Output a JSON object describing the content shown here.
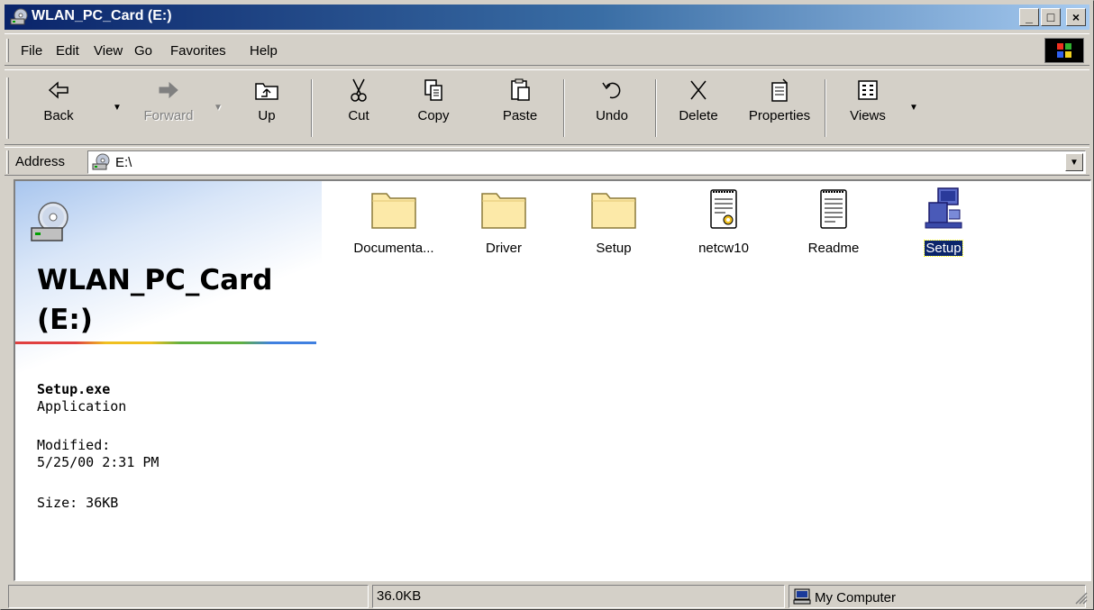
{
  "window": {
    "title": "WLAN_PC_Card (E:)"
  },
  "caption_buttons": {
    "minimize": "_",
    "maximize": "□",
    "close": "×"
  },
  "menu": {
    "items": [
      "File",
      "Edit",
      "View",
      "Go",
      "Favorites",
      "Help"
    ]
  },
  "toolbar": {
    "back": "Back",
    "forward": "Forward",
    "up": "Up",
    "cut": "Cut",
    "copy": "Copy",
    "paste": "Paste",
    "undo": "Undo",
    "delete": "Delete",
    "properties": "Properties",
    "views": "Views"
  },
  "address": {
    "label": "Address",
    "value": "E:\\"
  },
  "left_pane": {
    "title_line1": "WLAN_PC_Card",
    "title_line2": "(E:)",
    "file_name": "Setup.exe",
    "file_type": "Application",
    "modified_label": "Modified:",
    "modified_value": "5/25/00 2:31 PM",
    "size": "Size: 36KB"
  },
  "files": [
    {
      "name": "Documenta...",
      "icon": "folder-icon"
    },
    {
      "name": "Driver",
      "icon": "folder-icon"
    },
    {
      "name": "Setup",
      "icon": "folder-icon"
    },
    {
      "name": "netcw10",
      "icon": "setup-info-file-icon"
    },
    {
      "name": "Readme",
      "icon": "text-document-icon"
    },
    {
      "name": "Setup",
      "icon": "setup-application-icon",
      "selected": true
    }
  ],
  "status": {
    "size": "36.0KB",
    "zone": "My Computer"
  },
  "colors": {
    "titlebar_start": "#0a246a",
    "titlebar_end": "#a6caf0",
    "face": "#d4d0c8",
    "selection": "#0a246a"
  }
}
